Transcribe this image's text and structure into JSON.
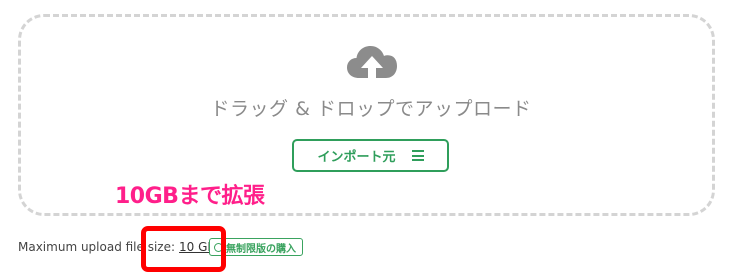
{
  "dropzone": {
    "icon": "cloud-upload-icon",
    "instruction": "ドラッグ & ドロップでアップロード",
    "import_button": {
      "label": "インポート元",
      "icon": "hamburger-menu-icon"
    }
  },
  "annotation": {
    "text": "10GBまで拡張",
    "color": "#ff1f8a",
    "highlight_color": "#ff0000"
  },
  "upload_limit": {
    "label": "Maximum upload file size:",
    "value": "10 GB",
    "unlimited_button": {
      "label": "無制限版の購入",
      "icon": "circle-icon"
    }
  },
  "colors": {
    "accent": "#2f9e5b",
    "dashed_border": "#d4d4d4",
    "muted_text": "#8a8a8a"
  }
}
